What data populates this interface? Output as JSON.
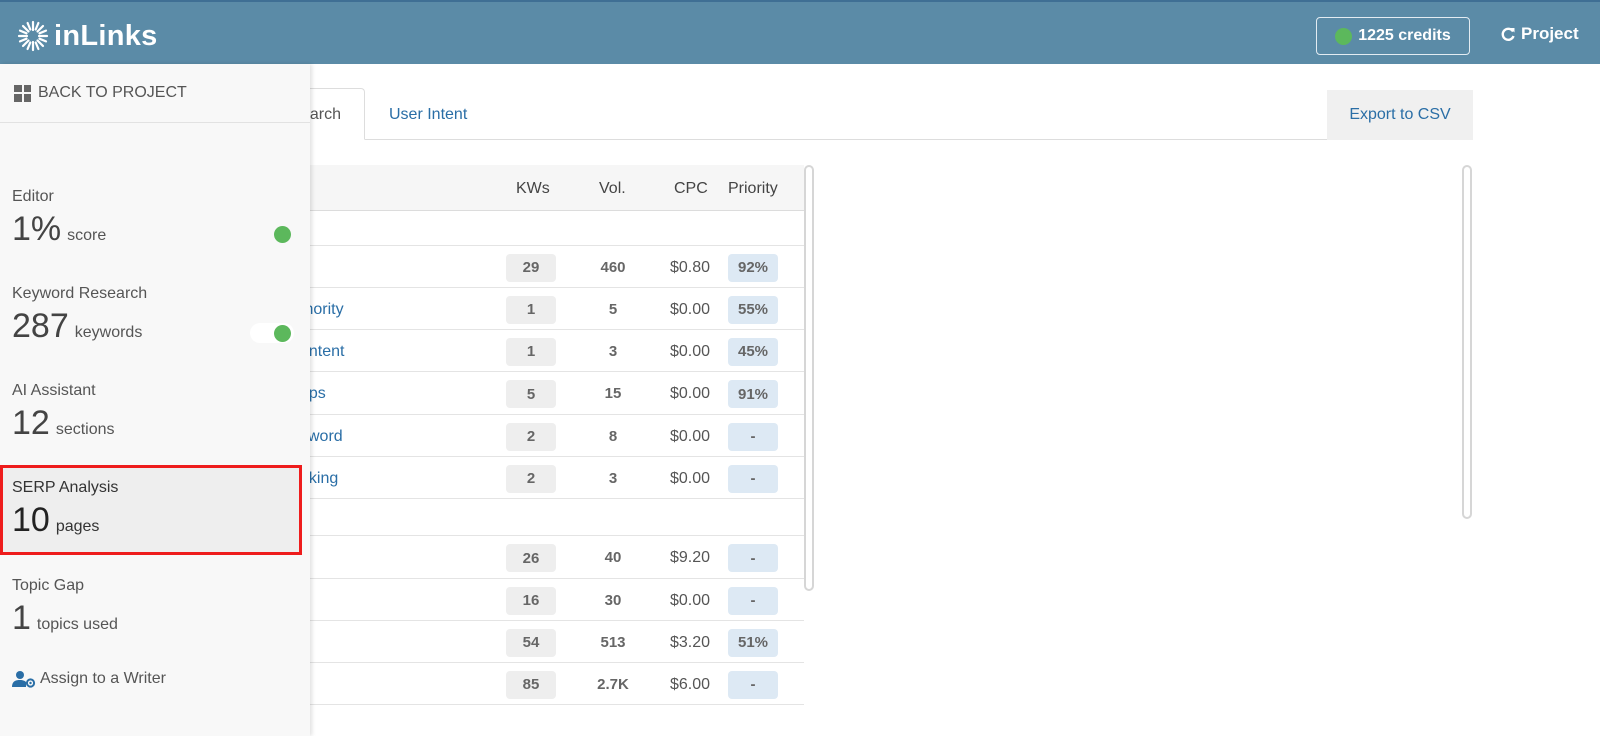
{
  "header": {
    "logo_text": "inLinks",
    "credits_label": "1225 credits",
    "project_label": "Project"
  },
  "tabs": {
    "keyword_research": "Keyword Research",
    "keyword_research_visible": "earch",
    "user_intent": "User Intent",
    "export": "Export to CSV"
  },
  "table": {
    "columns": [
      "KWs",
      "Vol.",
      "CPC",
      "Priority"
    ],
    "rows": [
      {
        "label": "",
        "kws": "",
        "vol": "",
        "cpc": "",
        "priority": ""
      },
      {
        "label": "",
        "kws": "29",
        "vol": "460",
        "cpc": "$0.80",
        "priority": "92%"
      },
      {
        "label": "thority",
        "kws": "1",
        "vol": "5",
        "cpc": "$0.00",
        "priority": "55%"
      },
      {
        "label": "ontent",
        "kws": "1",
        "vol": "3",
        "cpc": "$0.00",
        "priority": "45%"
      },
      {
        "label": "aps",
        "kws": "5",
        "vol": "15",
        "cpc": "$0.00",
        "priority": "91%"
      },
      {
        "label": "yword",
        "kws": "2",
        "vol": "8",
        "cpc": "$0.00",
        "priority": "-"
      },
      {
        "label": "nking",
        "kws": "2",
        "vol": "3",
        "cpc": "$0.00",
        "priority": "-"
      },
      {
        "label": "",
        "kws": "",
        "vol": "",
        "cpc": "",
        "priority": ""
      },
      {
        "label": "",
        "kws": "26",
        "vol": "40",
        "cpc": "$9.20",
        "priority": "-"
      },
      {
        "label": "",
        "kws": "16",
        "vol": "30",
        "cpc": "$0.00",
        "priority": "-"
      },
      {
        "label": "",
        "kws": "54",
        "vol": "513",
        "cpc": "$3.20",
        "priority": "51%"
      },
      {
        "label": "",
        "kws": "85",
        "vol": "2.7K",
        "cpc": "$6.00",
        "priority": "-"
      }
    ]
  },
  "sidebar": {
    "back_label": "BACK TO PROJECT",
    "sections": [
      {
        "label": "Editor",
        "value": "1%",
        "unit": "score",
        "indicator": "dot"
      },
      {
        "label": "Keyword Research",
        "value": "287",
        "unit": "keywords",
        "indicator": "toggle"
      },
      {
        "label": "AI Assistant",
        "value": "12",
        "unit": "sections",
        "indicator": "none"
      },
      {
        "label": "SERP Analysis",
        "value": "10",
        "unit": "pages",
        "indicator": "none",
        "highlighted": true
      },
      {
        "label": "Topic Gap",
        "value": "1",
        "unit": "topics used",
        "indicator": "none"
      }
    ],
    "assign_label": "Assign to a Writer"
  },
  "colors": {
    "header_bg": "#5b8ba7",
    "link_blue": "#2a6ea6",
    "status_green": "#5cb85c",
    "highlight_red": "#ee1c1c",
    "priority_pill": "#dde9f4"
  },
  "icons": {
    "logo": "sunburst-icon",
    "credits": "green-dot-icon",
    "project": "refresh-icon",
    "back": "grid-icon",
    "assign": "user-gear-icon"
  }
}
